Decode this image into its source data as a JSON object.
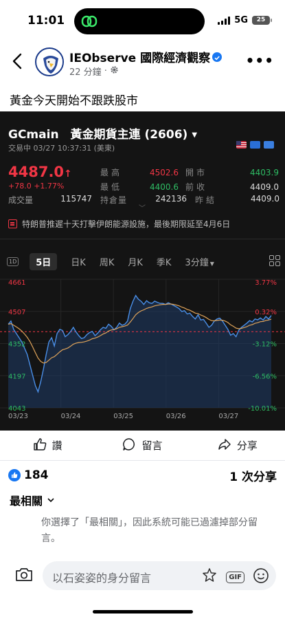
{
  "status_bar": {
    "time": "11:01",
    "network": "5G",
    "battery": "25"
  },
  "post": {
    "page_name": "IEObserve 國際經濟觀察",
    "time_ago": "22 分鐘",
    "text": "黃金今天開始不跟跌股市"
  },
  "quote": {
    "title": "GCmain　黃金期貨主連 (2606)",
    "status": "交易中 03/27 10:37:31 (美東)",
    "price": "4487.0",
    "change": "+78.0 +1.77%",
    "stats": [
      {
        "l1": "最高",
        "v1": "4502.6",
        "c1": "red",
        "l2": "開市",
        "v2": "4403.9",
        "c2": "green"
      },
      {
        "l1": "最低",
        "v1": "4400.6",
        "c1": "green",
        "l2": "前收",
        "v2": "4409.0",
        "c2": "white"
      }
    ],
    "volume_label": "成交量",
    "volume": "115747",
    "oi_label": "持倉量",
    "oi": "242136",
    "last_close_label": "昨結",
    "last_close": "4409.0",
    "news": "特朗普推遲十天打擊伊朗能源設施，最後期限延至4月6日"
  },
  "tabs": [
    "1D",
    "5日",
    "日K",
    "周K",
    "月K",
    "季K",
    "3分鐘"
  ],
  "chart_data": {
    "type": "line",
    "x_ticks": [
      "03/23",
      "03/24",
      "03/25",
      "03/26",
      "03/27"
    ],
    "y_ticks_left": [
      "4661",
      "4507",
      "4352",
      "4197",
      "4043"
    ],
    "y_ticks_right": [
      "3.77%",
      "0.32%",
      "-3.12%",
      "-6.56%",
      "-10.01%"
    ],
    "ylim": [
      4043,
      4661
    ],
    "reference_price": 4409.0,
    "series": [
      {
        "values": [
          4445,
          4460,
          4420,
          4400,
          4380,
          4360,
          4330,
          4300,
          4250,
          4200,
          4150,
          4120,
          4170,
          4230,
          4300,
          4360,
          4380,
          4340,
          4400,
          4420,
          4415,
          4385,
          4395,
          4410,
          4430,
          4408,
          4390,
          4376,
          4380,
          4395,
          4405,
          4410,
          4390,
          4402,
          4418,
          4430,
          4425,
          4445,
          4435,
          4418,
          4430,
          4450,
          4440,
          4445,
          4460,
          4520,
          4555,
          4583,
          4565,
          4555,
          4540,
          4558,
          4548,
          4545,
          4556,
          4550,
          4545,
          4545,
          4540,
          4548,
          4542,
          4535,
          4528,
          4520,
          4506,
          4510,
          4494,
          4498,
          4482,
          4470,
          4490,
          4465,
          4468,
          4450,
          4430,
          4440,
          4460,
          4470,
          4474,
          4460,
          4440,
          4420,
          4392,
          4400,
          4385,
          4415,
          4430,
          4440,
          4450,
          4462,
          4456,
          4470,
          4466,
          4475,
          4465,
          4482,
          4470,
          4487
        ]
      },
      {
        "values": [
          4445,
          4448,
          4440,
          4432,
          4423,
          4412,
          4398,
          4382,
          4362,
          4336,
          4308,
          4282,
          4266,
          4258,
          4261,
          4272,
          4284,
          4289,
          4300,
          4312,
          4322,
          4326,
          4331,
          4339,
          4349,
          4354,
          4357,
          4358,
          4360,
          4364,
          4369,
          4375,
          4378,
          4383,
          4390,
          4398,
          4403,
          4412,
          4417,
          4419,
          4423,
          4430,
          4433,
          4436,
          4441,
          4455,
          4472,
          4490,
          4501,
          4509,
          4514,
          4521,
          4525,
          4528,
          4533,
          4536,
          4538,
          4540,
          4540,
          4542,
          4542,
          4540,
          4537,
          4533,
          4527,
          4523,
          4516,
          4512,
          4505,
          4498,
          4496,
          4489,
          4484,
          4477,
          4468,
          4462,
          4461,
          4463,
          4465,
          4464,
          4460,
          4453,
          4442,
          4435,
          4426,
          4423,
          4425,
          4429,
          4433,
          4440,
          4443,
          4449,
          4452,
          4457,
          4458,
          4463,
          4465,
          4469
        ]
      }
    ]
  },
  "actions": {
    "like": "讚",
    "comment": "留言",
    "share": "分享"
  },
  "reactions": {
    "count": "184",
    "shares": "1 次分享"
  },
  "comments": {
    "sort_label": "最相關",
    "notice": "你選擇了「最相關」，因此系統可能已過濾掉部分留言。",
    "placeholder": "以石姿姿的身分留言"
  },
  "colors": {
    "up": "#f23645",
    "down": "#2ebd64",
    "accent": "#1877f2",
    "chart_bg": "#141414",
    "line": "#4a8fe8",
    "ma": "#e0a45a"
  }
}
